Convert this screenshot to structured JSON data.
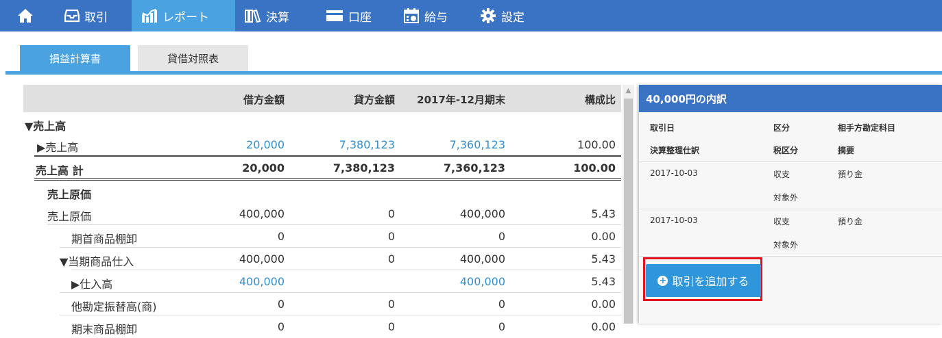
{
  "nav": {
    "items": [
      {
        "label": "取引",
        "icon": "inbox-icon"
      },
      {
        "label": "レポート",
        "icon": "bar-chart-icon"
      },
      {
        "label": "決算",
        "icon": "books-icon"
      },
      {
        "label": "口座",
        "icon": "card-icon"
      },
      {
        "label": "給与",
        "icon": "calendar-icon"
      },
      {
        "label": "設定",
        "icon": "gear-icon"
      }
    ],
    "active": "レポート",
    "colors": {
      "bar": "#3b73c4",
      "active": "#4aa3e0"
    }
  },
  "tabs": [
    {
      "label": "損益計算書",
      "active": true
    },
    {
      "label": "貸借対照表",
      "active": false
    }
  ],
  "table": {
    "headers": [
      "借方金額",
      "貸方金額",
      "2017年-12月期末",
      "構成比"
    ],
    "rows": [
      {
        "label": "▼売上高",
        "values": [
          "",
          "",
          "",
          ""
        ]
      },
      {
        "label": "▶売上高",
        "values": [
          "20,000",
          "7,380,123",
          "7,360,123",
          "100.00"
        ]
      },
      {
        "label": "売上高 計",
        "values": [
          "20,000",
          "7,380,123",
          "7,360,123",
          "100.00"
        ]
      },
      {
        "label": "売上原価",
        "values": [
          "",
          "",
          "",
          ""
        ]
      },
      {
        "label": "売上原価",
        "values": [
          "400,000",
          "0",
          "400,000",
          "5.43"
        ]
      },
      {
        "label": "期首商品棚卸",
        "values": [
          "0",
          "0",
          "0",
          "0.00"
        ]
      },
      {
        "label": "▼当期商品仕入",
        "values": [
          "400,000",
          "0",
          "400,000",
          "5.43"
        ]
      },
      {
        "label": "▶仕入高",
        "values": [
          "400,000",
          "",
          "400,000",
          "5.43"
        ]
      },
      {
        "label": "他勘定振替高(商)",
        "values": [
          "0",
          "0",
          "0",
          "0.00"
        ]
      },
      {
        "label": "期末商品棚卸",
        "values": [
          "0",
          "0",
          "0",
          "0.00"
        ]
      }
    ]
  },
  "panel": {
    "title": "40,000円の内訳",
    "headers": [
      "取引日",
      "区分",
      "相手方勘定科目",
      "決算整理仕訳",
      "税区分",
      "摘要"
    ],
    "entries": [
      {
        "date": "2017-10-03",
        "kind": "収支",
        "account": "預り金",
        "tax": "対象外"
      },
      {
        "date": "2017-10-03",
        "kind": "収支",
        "account": "預り金",
        "tax": "対象外"
      }
    ],
    "add_button": "取引を追加する"
  }
}
